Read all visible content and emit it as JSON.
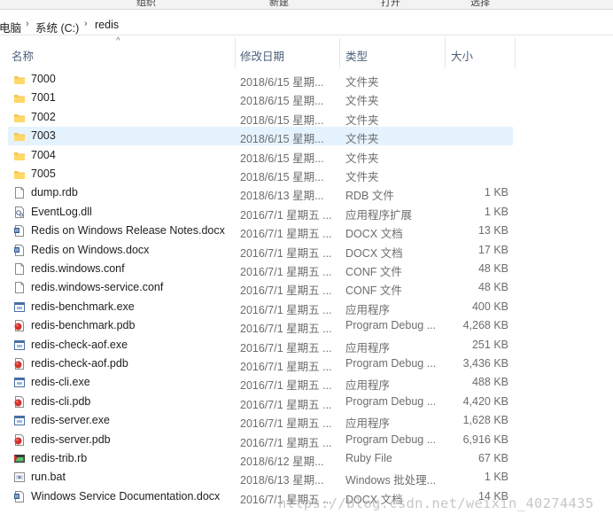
{
  "ribbon": {
    "labels": [
      "组织",
      "新建",
      "打开",
      "选择"
    ]
  },
  "breadcrumb": {
    "items": [
      "电脑",
      "系统 (C:)",
      "redis"
    ]
  },
  "columns": {
    "name": "名称",
    "date": "修改日期",
    "type": "类型",
    "size": "大小"
  },
  "selected_row": 3,
  "files": [
    {
      "name": "7000",
      "date": "2018/6/15 星期...",
      "type": "文件夹",
      "size": "",
      "icon": "folder-icon"
    },
    {
      "name": "7001",
      "date": "2018/6/15 星期...",
      "type": "文件夹",
      "size": "",
      "icon": "folder-icon"
    },
    {
      "name": "7002",
      "date": "2018/6/15 星期...",
      "type": "文件夹",
      "size": "",
      "icon": "folder-icon"
    },
    {
      "name": "7003",
      "date": "2018/6/15 星期...",
      "type": "文件夹",
      "size": "",
      "icon": "folder-icon"
    },
    {
      "name": "7004",
      "date": "2018/6/15 星期...",
      "type": "文件夹",
      "size": "",
      "icon": "folder-icon"
    },
    {
      "name": "7005",
      "date": "2018/6/15 星期...",
      "type": "文件夹",
      "size": "",
      "icon": "folder-icon"
    },
    {
      "name": "dump.rdb",
      "date": "2018/6/13 星期...",
      "type": "RDB 文件",
      "size": "1 KB",
      "icon": "blank-file-icon"
    },
    {
      "name": "EventLog.dll",
      "date": "2016/7/1 星期五 ...",
      "type": "应用程序扩展",
      "size": "1 KB",
      "icon": "dll-file-icon"
    },
    {
      "name": "Redis on Windows Release Notes.docx",
      "date": "2016/7/1 星期五 ...",
      "type": "DOCX 文档",
      "size": "13 KB",
      "icon": "docx-file-icon"
    },
    {
      "name": "Redis on Windows.docx",
      "date": "2016/7/1 星期五 ...",
      "type": "DOCX 文档",
      "size": "17 KB",
      "icon": "docx-file-icon"
    },
    {
      "name": "redis.windows.conf",
      "date": "2016/7/1 星期五 ...",
      "type": "CONF 文件",
      "size": "48 KB",
      "icon": "blank-file-icon"
    },
    {
      "name": "redis.windows-service.conf",
      "date": "2016/7/1 星期五 ...",
      "type": "CONF 文件",
      "size": "48 KB",
      "icon": "blank-file-icon"
    },
    {
      "name": "redis-benchmark.exe",
      "date": "2016/7/1 星期五 ...",
      "type": "应用程序",
      "size": "400 KB",
      "icon": "exe-file-icon"
    },
    {
      "name": "redis-benchmark.pdb",
      "date": "2016/7/1 星期五 ...",
      "type": "Program Debug ...",
      "size": "4,268 KB",
      "icon": "pdb-file-icon"
    },
    {
      "name": "redis-check-aof.exe",
      "date": "2016/7/1 星期五 ...",
      "type": "应用程序",
      "size": "251 KB",
      "icon": "exe-file-icon"
    },
    {
      "name": "redis-check-aof.pdb",
      "date": "2016/7/1 星期五 ...",
      "type": "Program Debug ...",
      "size": "3,436 KB",
      "icon": "pdb-file-icon"
    },
    {
      "name": "redis-cli.exe",
      "date": "2016/7/1 星期五 ...",
      "type": "应用程序",
      "size": "488 KB",
      "icon": "exe-file-icon"
    },
    {
      "name": "redis-cli.pdb",
      "date": "2016/7/1 星期五 ...",
      "type": "Program Debug ...",
      "size": "4,420 KB",
      "icon": "pdb-file-icon"
    },
    {
      "name": "redis-server.exe",
      "date": "2016/7/1 星期五 ...",
      "type": "应用程序",
      "size": "1,628 KB",
      "icon": "exe-file-icon"
    },
    {
      "name": "redis-server.pdb",
      "date": "2016/7/1 星期五 ...",
      "type": "Program Debug ...",
      "size": "6,916 KB",
      "icon": "pdb-file-icon"
    },
    {
      "name": "redis-trib.rb",
      "date": "2018/6/12 星期...",
      "type": "Ruby File",
      "size": "67 KB",
      "icon": "ruby-file-icon"
    },
    {
      "name": "run.bat",
      "date": "2018/6/13 星期...",
      "type": "Windows 批处理...",
      "size": "1 KB",
      "icon": "bat-file-icon"
    },
    {
      "name": "Windows Service Documentation.docx",
      "date": "2016/7/1 星期五 ...",
      "type": "DOCX 文档",
      "size": "14 KB",
      "icon": "docx-file-icon"
    }
  ],
  "watermark": "https://blog.csdn.net/weixin_40274435"
}
